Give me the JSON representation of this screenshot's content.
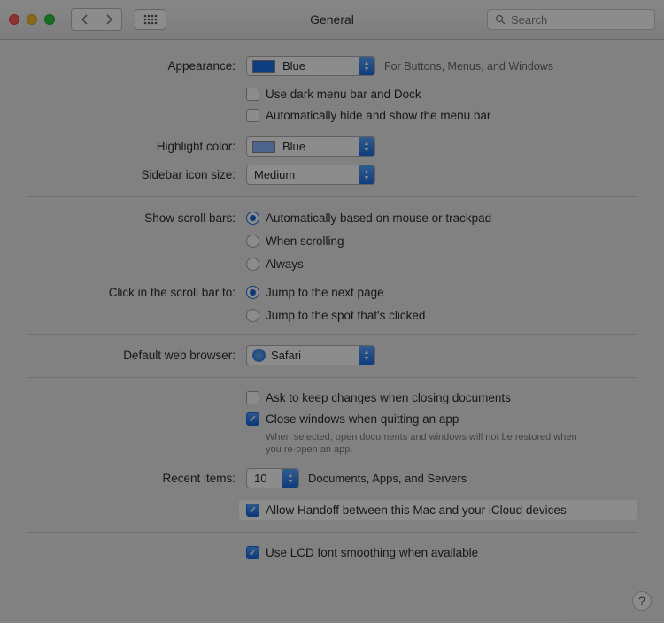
{
  "window": {
    "title": "General",
    "searchPlaceholder": "Search"
  },
  "appearance": {
    "label": "Appearance:",
    "value": "Blue",
    "swatch": "#1a6fe8",
    "hint": "For Buttons, Menus, and Windows",
    "darkMenuBar": "Use dark menu bar and Dock",
    "autoHideMenuBar": "Automatically hide and show the menu bar"
  },
  "highlight": {
    "label": "Highlight color:",
    "value": "Blue",
    "swatch": "#8cb8ff"
  },
  "sidebarIcon": {
    "label": "Sidebar icon size:",
    "value": "Medium"
  },
  "scrollBars": {
    "label": "Show scroll bars:",
    "options": [
      "Automatically based on mouse or trackpad",
      "When scrolling",
      "Always"
    ],
    "selectedIndex": 0
  },
  "scrollClick": {
    "label": "Click in the scroll bar to:",
    "options": [
      "Jump to the next page",
      "Jump to the spot that's clicked"
    ],
    "selectedIndex": 0
  },
  "browser": {
    "label": "Default web browser:",
    "value": "Safari"
  },
  "askToKeep": "Ask to keep changes when closing documents",
  "closeWindows": {
    "label": "Close windows when quitting an app",
    "hint": "When selected, open documents and windows will not be restored when you re-open an app."
  },
  "recentItems": {
    "label": "Recent items:",
    "value": "10",
    "suffix": "Documents, Apps, and Servers"
  },
  "handoff": "Allow Handoff between this Mac and your iCloud devices",
  "lcd": "Use LCD font smoothing when available"
}
